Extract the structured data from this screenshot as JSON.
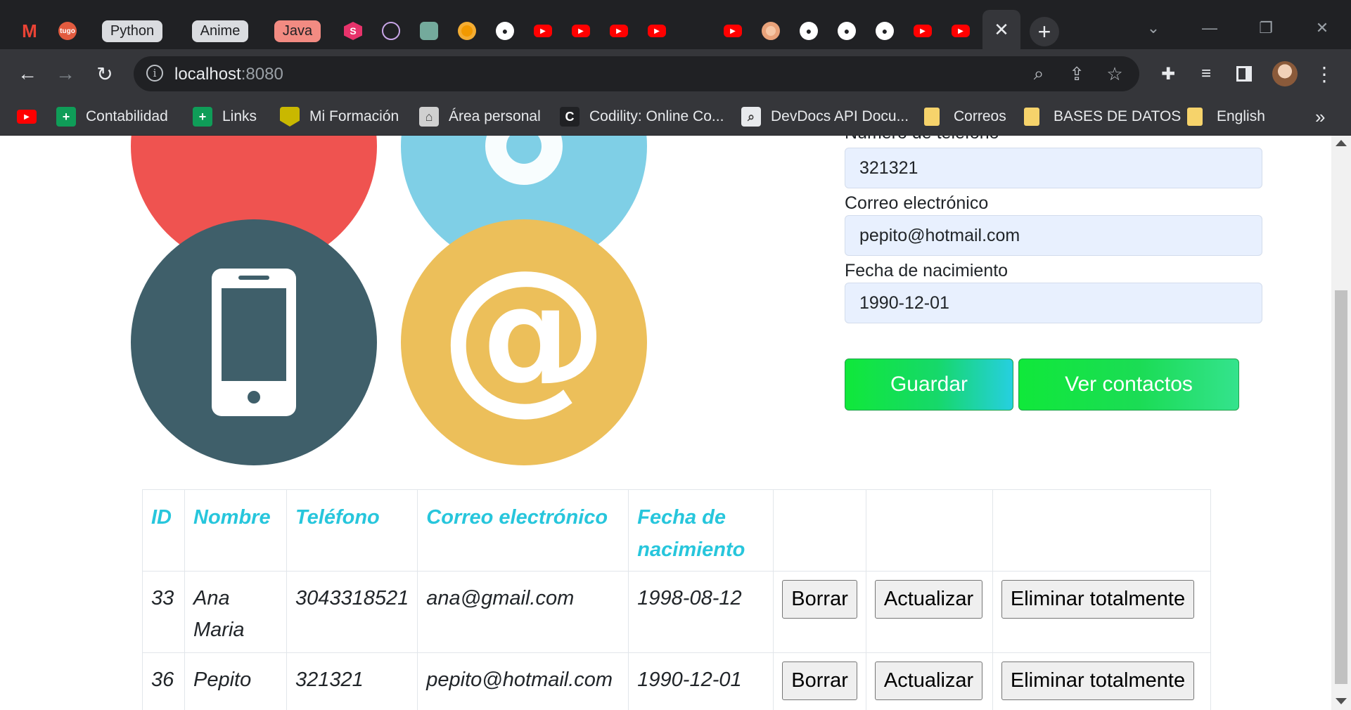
{
  "browser": {
    "tab_groups": [
      {
        "label": "Python",
        "color": "#dadce0"
      },
      {
        "label": "Anime",
        "color": "#dadce0"
      },
      {
        "label": "Java",
        "color": "#f28b82"
      }
    ],
    "window_controls": {
      "dropdown": "⌄",
      "minimize": "—",
      "restore": "❐",
      "close": "✕"
    },
    "new_tab": "+",
    "active_tab_close": "✕",
    "url_host": "localhost",
    "url_port": ":8080",
    "bookmarks": [
      {
        "label": "",
        "icon": "youtube-icon"
      },
      {
        "label": "Contabilidad",
        "icon": "sheets-icon"
      },
      {
        "label": "Links",
        "icon": "sheets-icon"
      },
      {
        "label": "Mi Formación",
        "icon": "formacion-icon"
      },
      {
        "label": "Área personal",
        "icon": "moodle-icon"
      },
      {
        "label": "Codility: Online Co...",
        "icon": "codility-icon"
      },
      {
        "label": "DevDocs API Docu...",
        "icon": "devdocs-icon"
      },
      {
        "label": "Correos",
        "icon": "folder-icon"
      },
      {
        "label": "BASES DE DATOS",
        "icon": "folder-icon"
      },
      {
        "label": "English",
        "icon": "folder-icon"
      }
    ],
    "bookmarks_overflow": "»"
  },
  "form": {
    "phone_label": "Número de teléfono",
    "phone_value": "321321",
    "email_label": "Correo electrónico",
    "email_value": "pepito@hotmail.com",
    "birth_label": "Fecha de nacimiento",
    "birth_value": "1990-12-01",
    "save_button": "Guardar",
    "view_button": "Ver contactos"
  },
  "table": {
    "headers": [
      "ID",
      "Nombre",
      "Teléfono",
      "Correo electrónico",
      "Fecha de nacimiento"
    ],
    "rows": [
      {
        "id": "33",
        "name": "Ana Maria",
        "phone": "3043318521",
        "email": "ana@gmail.com",
        "birth": "1998-08-12"
      },
      {
        "id": "36",
        "name": "Pepito",
        "phone": "321321",
        "email": "pepito@hotmail.com",
        "birth": "1990-12-01"
      }
    ],
    "actions": {
      "delete": "Borrar",
      "update": "Actualizar",
      "purge": "Eliminar totalmente"
    }
  },
  "colors": {
    "header_text": "#27c6dc",
    "button_gradient_start": "#10e83a",
    "button_gradient_end": "#26cfe0",
    "input_bg": "#e8f0fe"
  }
}
